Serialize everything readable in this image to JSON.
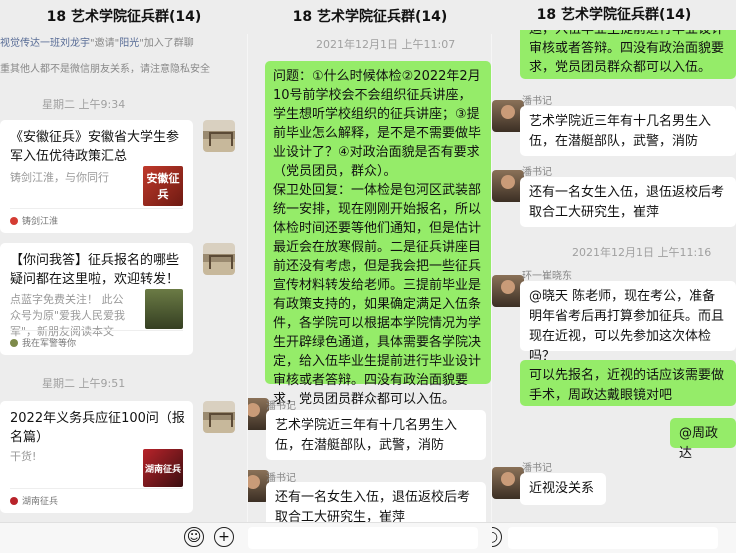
{
  "panel1": {
    "title": "18 艺术学院征兵群(14)",
    "sys_line1_prefix": "视觉传达一班刘龙宇",
    "sys_line1_mid": "\"邀请\"",
    "sys_line1_name": "阳光",
    "sys_line1_suffix": "\"加入了群聊",
    "sys_line2": "重其他人都不是微信朋友关系，请注意隐私安全",
    "time1": "星期二 上午9:34",
    "card1": {
      "title": "《安徽征兵》安徽省大学生参军入伍优待政策汇总",
      "desc": "铸剑江淮，与你同行",
      "thumb_text": "安徽征兵",
      "source": "铸剑江淮"
    },
    "card2": {
      "title": "【你问我答】征兵报名的哪些疑问都在这里啦，欢迎转发！",
      "desc": "点蓝字免费关注！ 此公众号为原\"爱我人民爱我军\"，新朋友阅读本文前，请先点...",
      "source": "我在军警等你"
    },
    "time2": "星期二 上午9:51",
    "card3": {
      "title": "2022年义务兵应征100问（报名篇）",
      "desc": "干货!",
      "thumb_text": "湖南征兵",
      "source": "湖南征兵"
    }
  },
  "panel2": {
    "title": "18 艺术学院征兵群(14)",
    "time": "2021年12月1日 上午11:07",
    "green_msg": "问题：①什么时候体检②2022年2月10号前学校会不会组织征兵讲座，学生想听学校组织的征兵讲座；③提前毕业怎么解释，是不是不需要做毕业设计了？④对政治面貌是否有要求（党员团员，群众）。\n保卫处回复：一体检是包河区武装部统一安排，现在刚刚开始报名，所以体检时间还要等他们通知，但是估计最近会在放寒假前。二是征兵讲座目前还没有考虑，但是我会把一些征兵宣传材料转发给老师。三提前毕业是有政策支持的，如果确定满足入伍条件，各学院可以根据本学院情况为学生开辟绿色通道，具体需要各学院决定，给入伍毕业生提前进行毕业设计审核或者答辩。四没有政治面貌要求，党员团员群众都可以入伍。",
    "sender1": "潘书记",
    "msg1": "艺术学院近三年有十几名男生入伍，在潜艇部队，武警，消防",
    "sender2": "潘书记",
    "msg2": "还有一名女生入伍，退伍返校后考取合工大研究生，崔萍"
  },
  "panel3": {
    "title": "18 艺术学院征兵群(14)",
    "top_msg_partial": "运，入伍毕业生提前进行毕业设计审核或者答辩。四没有政治面貌要求，党员团员群众都可以入伍。",
    "sender1": "潘书记",
    "msg1": "艺术学院近三年有十几名男生入伍，在潜艇部队，武警，消防",
    "sender2": "潘书记",
    "msg2": "还有一名女生入伍，退伍返校后考取合工大研究生，崔萍",
    "time": "2021年12月1日 上午11:16",
    "sender3": "环一崔晓东",
    "msg3": "@晓天 陈老师，现在考公，准备明年省考后再打算参加征兵。而且现在近视，可以先参加这次体检吗？",
    "green_msg1": "可以先报名，近视的话应该需要做手术，周政达戴眼镜对吧",
    "green_msg2": "@周政达",
    "sender4": "潘书记",
    "msg4": "近视没关系"
  },
  "icons": {
    "voice": "voice-icon",
    "emoji": "emoji-icon",
    "plus": "plus-icon"
  }
}
